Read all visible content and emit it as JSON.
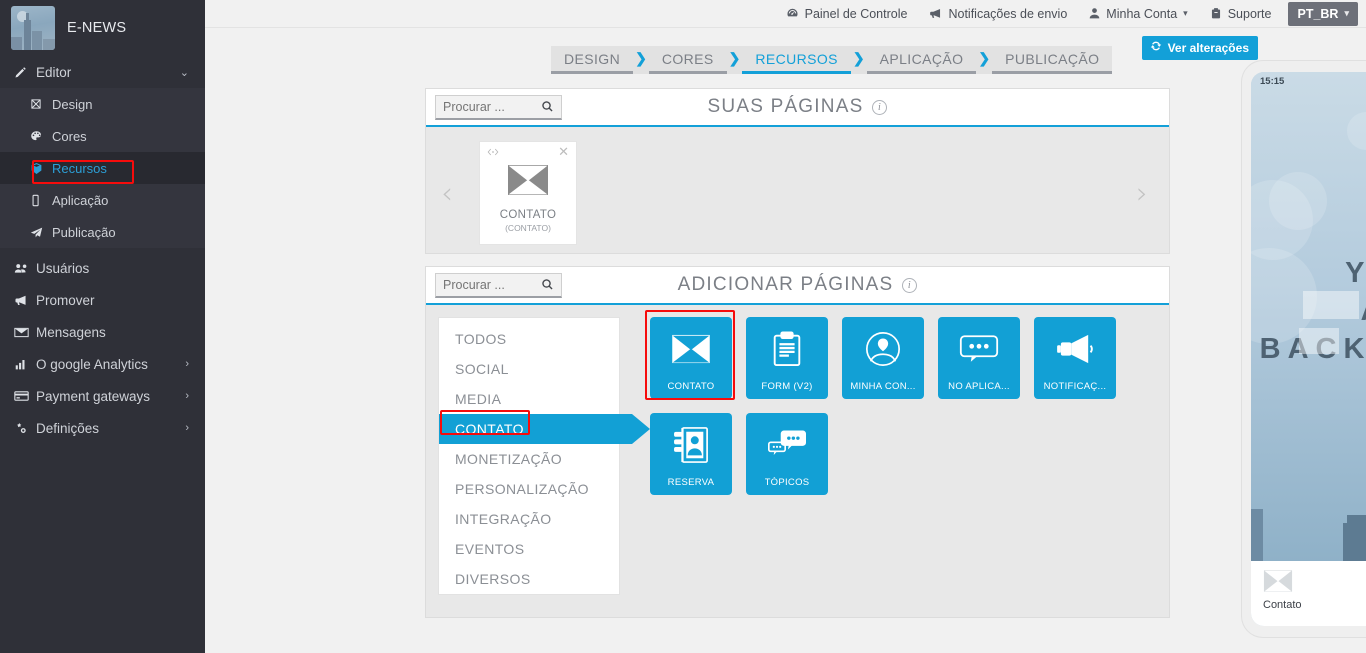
{
  "sidebar": {
    "brand": "E-NEWS",
    "items": [
      {
        "label": "Editor",
        "icon": "pencil-icon",
        "caret": "⌄",
        "children": [
          {
            "label": "Design",
            "icon": "design-icon"
          },
          {
            "label": "Cores",
            "icon": "palette-icon"
          },
          {
            "label": "Recursos",
            "icon": "cube-icon",
            "active": true
          },
          {
            "label": "Aplicação",
            "icon": "mobile-icon"
          },
          {
            "label": "Publicação",
            "icon": "paper-plane-icon"
          }
        ]
      },
      {
        "label": "Usuários",
        "icon": "users-icon"
      },
      {
        "label": "Promover",
        "icon": "megaphone-icon"
      },
      {
        "label": "Mensagens",
        "icon": "envelope-icon"
      },
      {
        "label": "O google Analytics",
        "icon": "bar-chart-icon",
        "caret": "›"
      },
      {
        "label": "Payment gateways",
        "icon": "credit-card-icon",
        "caret": "›"
      },
      {
        "label": "Definições",
        "icon": "gears-icon",
        "caret": "›"
      }
    ]
  },
  "topbar": {
    "links": [
      {
        "label": "Painel de Controle",
        "icon": "dashboard-icon"
      },
      {
        "label": "Notificações de envio",
        "icon": "bullhorn-icon"
      },
      {
        "label": "Minha Conta",
        "icon": "user-icon",
        "caret": "▾"
      },
      {
        "label": "Suporte",
        "icon": "lifebuoy-icon"
      }
    ],
    "language": "PT_BR",
    "language_caret": "▾",
    "view_changes": "Ver alterações",
    "view_changes_icon": "refresh-icon"
  },
  "breadcrumb": {
    "separator": "❯",
    "items": [
      {
        "label": "DESIGN",
        "active": false
      },
      {
        "label": "CORES",
        "active": false
      },
      {
        "label": "RECURSOS",
        "active": true
      },
      {
        "label": "APLICAÇÃO",
        "active": false
      },
      {
        "label": "PUBLICAÇÃO",
        "active": false
      }
    ]
  },
  "your_pages": {
    "title": "SUAS PÁGINAS",
    "search_placeholder": "Procurar ...",
    "search_value": "",
    "prev_arrow": "‹",
    "next_arrow": "›",
    "cards": [
      {
        "label": "CONTATO",
        "sublabel": "(CONTATO)",
        "icon": "envelope-icon",
        "code_icon": "code-icon",
        "close_icon": "close-icon"
      }
    ]
  },
  "add_pages": {
    "title": "ADICIONAR PÁGINAS",
    "search_placeholder": "Procurar ...",
    "search_value": "",
    "categories": [
      {
        "label": "TODOS",
        "active": false
      },
      {
        "label": "SOCIAL",
        "active": false
      },
      {
        "label": "MEDIA",
        "active": false
      },
      {
        "label": "CONTATO",
        "active": true
      },
      {
        "label": "MONETIZAÇÃO",
        "active": false
      },
      {
        "label": "PERSONALIZAÇÃO",
        "active": false
      },
      {
        "label": "INTEGRAÇÃO",
        "active": false
      },
      {
        "label": "EVENTOS",
        "active": false
      },
      {
        "label": "DIVERSOS",
        "active": false
      }
    ],
    "tiles": [
      {
        "label": "CONTATO",
        "icon": "envelope-icon",
        "highlighted": true
      },
      {
        "label": "FORM (V2)",
        "icon": "clipboard-icon",
        "highlighted": false
      },
      {
        "label": "MINHA CON...",
        "icon": "contact-circle-icon",
        "highlighted": false
      },
      {
        "label": "NO APLICA...",
        "icon": "chat-bubble-icon",
        "highlighted": false
      },
      {
        "label": "NOTIFICAÇ...",
        "icon": "megaphone-icon",
        "highlighted": false
      },
      {
        "label": "RESERVA",
        "icon": "address-book-icon",
        "highlighted": false
      },
      {
        "label": "TÓPICOS",
        "icon": "chat-bubbles-icon",
        "highlighted": false
      }
    ]
  },
  "phone_preview": {
    "status_time": "15:15",
    "status_icons": [
      "signal-icon",
      "wifi-icon",
      "battery-icon"
    ],
    "wallpaper_text": [
      "YOUR",
      "APP",
      "BACKGROUND"
    ],
    "dock": [
      {
        "label": "Contato",
        "icon": "envelope-icon"
      }
    ]
  },
  "colors": {
    "accent": "#12a0d5",
    "accent_button": "#13a0d8",
    "sidebar_bg": "#2f3038",
    "highlight_border": "#f60c0c",
    "panel_bg": "#e8e8e8",
    "page_bg": "#f1f1f1"
  }
}
